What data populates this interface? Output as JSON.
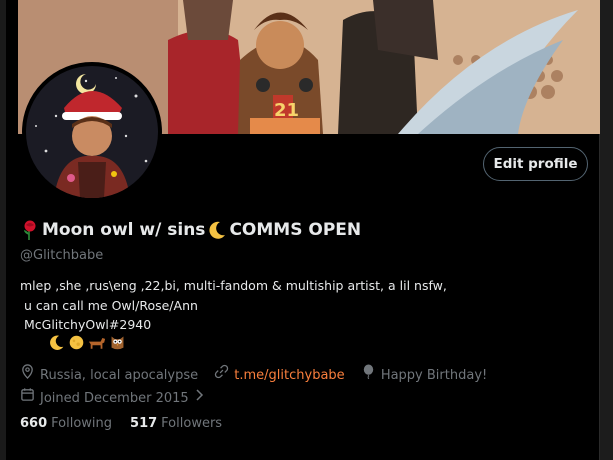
{
  "profile": {
    "name_text": "Moon owl w/ sins",
    "name_status": "COMMS OPEN",
    "handle": "@Glitchbabe",
    "bio_lines": [
      "mlep ,she ,rus\\eng ,22,bi, multi-fandom & multiship artist, a lil nsfw,",
      " u can call me Owl/Rose/Ann",
      " McGlitchyOwl#2940"
    ],
    "edit_button_label": "Edit profile",
    "location": "Russia, local apocalypse",
    "link": "t.me/glitchybabe",
    "birthday": "Happy Birthday!",
    "joined": "Joined December 2015",
    "following_count": "660",
    "following_label": "Following",
    "followers_count": "517",
    "followers_label": "Followers"
  },
  "icons": {
    "name_prefix": "rose-icon",
    "name_suffix": "crescent-moon-icon",
    "bio_emoji": [
      "crescent-moon-icon",
      "full-moon-icon",
      "dog-icon",
      "owl-icon"
    ],
    "meta": [
      "location-pin-icon",
      "link-icon",
      "balloon-icon",
      "calendar-icon",
      "chevron-right-icon"
    ]
  },
  "colors": {
    "background": "#000000",
    "text": "#e7e9ea",
    "muted": "#71767b",
    "link": "#f97f3d",
    "button_border": "#536471"
  }
}
